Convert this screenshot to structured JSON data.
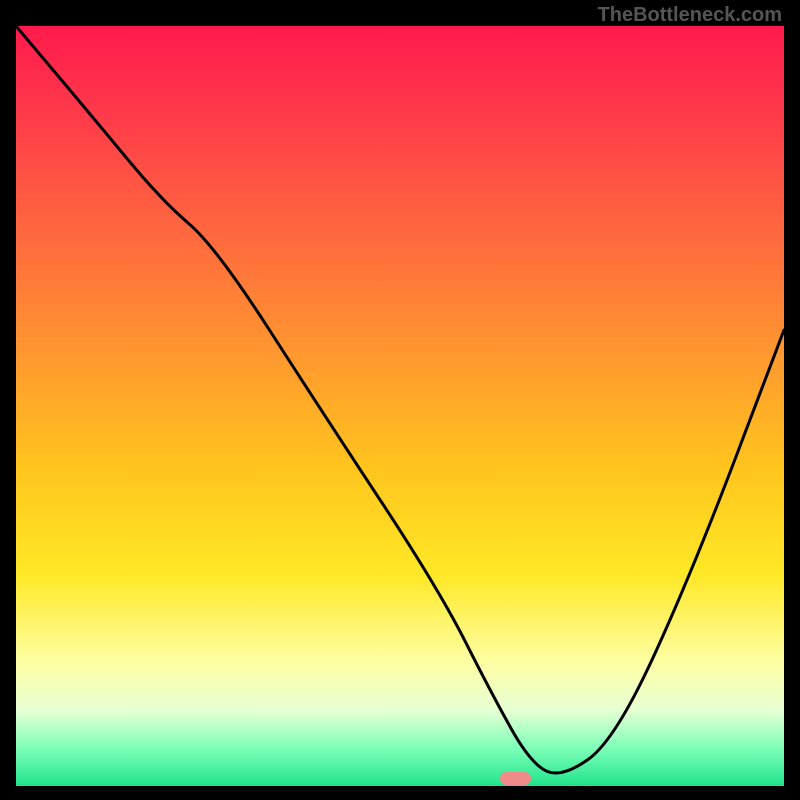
{
  "watermark": "TheBottleneck.com",
  "chart_data": {
    "type": "line",
    "title": "",
    "xlabel": "",
    "ylabel": "",
    "xlim": [
      0,
      100
    ],
    "ylim": [
      0,
      100
    ],
    "gradient_stops": [
      {
        "pos": 0,
        "color": "#ff1a4d"
      },
      {
        "pos": 12,
        "color": "#ff3b4a"
      },
      {
        "pos": 28,
        "color": "#ff6a3e"
      },
      {
        "pos": 44,
        "color": "#ff9a2e"
      },
      {
        "pos": 58,
        "color": "#ffc41e"
      },
      {
        "pos": 72,
        "color": "#ffe825"
      },
      {
        "pos": 84,
        "color": "#fdffa6"
      },
      {
        "pos": 90,
        "color": "#e6ffd3"
      },
      {
        "pos": 95,
        "color": "#7effb8"
      },
      {
        "pos": 100,
        "color": "#1fe38a"
      }
    ],
    "series": [
      {
        "name": "bottleneck-curve",
        "x": [
          0,
          10,
          19,
          26,
          40,
          55,
          62,
          67,
          71,
          78,
          88,
          100
        ],
        "y": [
          100,
          88,
          77,
          71,
          49,
          26,
          12,
          3,
          1,
          6,
          28,
          60
        ]
      }
    ],
    "marker": {
      "x": 65,
      "y": 1,
      "width_pct": 4,
      "height_pct": 1.8,
      "color": "#f08b89"
    }
  }
}
